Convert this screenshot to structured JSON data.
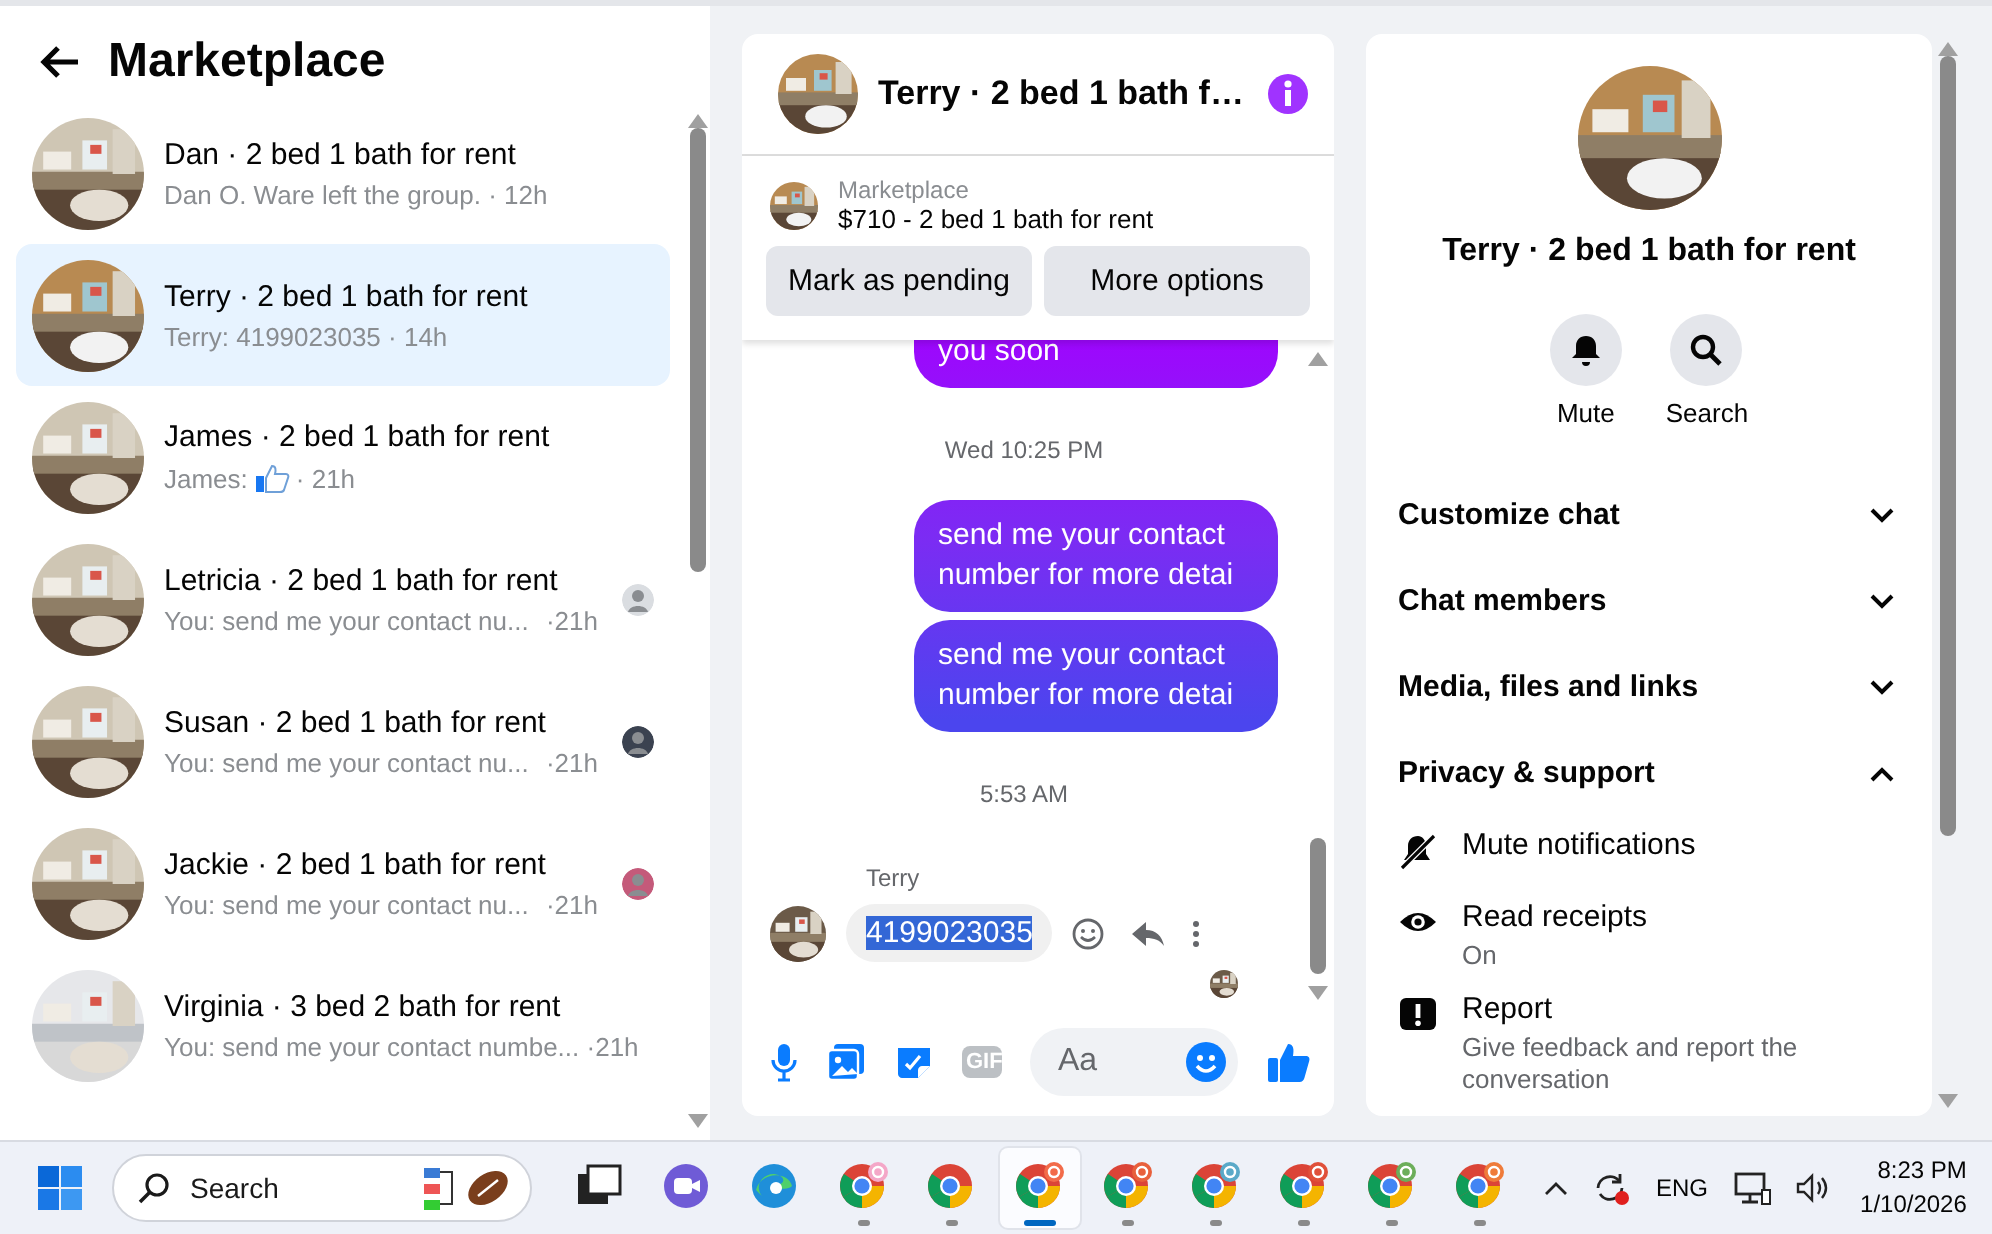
{
  "sidebar": {
    "title": "Marketplace",
    "conversations": [
      {
        "title": "Dan · 2 bed 1 bath for rent",
        "preview": "Dan O. Ware left the group. · 12h",
        "selected": false
      },
      {
        "title": "Terry · 2 bed 1 bath for rent",
        "preview": "Terry: 4199023035 · 14h",
        "selected": true
      },
      {
        "title": "James · 2 bed 1 bath for rent",
        "preview": "James:",
        "preview_like": true,
        "time": "· 21h",
        "selected": false
      },
      {
        "title": "Letricia · 2 bed 1 bath for rent",
        "preview": "You: send me your contact nu...",
        "time": "·21h",
        "selected": false,
        "seen_by": {
          "color": "#dadde1"
        }
      },
      {
        "title": "Susan · 2 bed 1 bath for rent",
        "preview": "You: send me your contact nu...",
        "time": "·21h",
        "selected": false,
        "seen_by": {
          "color": "#3b4250"
        }
      },
      {
        "title": "Jackie · 2 bed 1 bath for rent",
        "preview": "You: send me your contact nu...",
        "time": "·21h",
        "selected": false,
        "seen_by": {
          "color": "#c45a7a"
        }
      },
      {
        "title": "Virginia · 3 bed 2 bath for rent",
        "preview": "You: send me your contact numbe... ·21h",
        "selected": false
      }
    ]
  },
  "chat": {
    "title": "Terry · 2 bed 1 bath f…",
    "listing": {
      "source": "Marketplace",
      "name": "$710 - 2 bed 1 bath for rent"
    },
    "actions": [
      "Mark as pending",
      "More options"
    ],
    "messages": [
      {
        "kind": "sent",
        "text": "you soon"
      },
      {
        "kind": "time",
        "text": "Wed 10:25 PM"
      },
      {
        "kind": "sent",
        "text": "send me your contact number for more detai"
      },
      {
        "kind": "sent",
        "text": "send me your contact number for more detai"
      },
      {
        "kind": "time",
        "text": "5:53 AM"
      },
      {
        "kind": "received",
        "sender": "Terry",
        "text": "4199023035",
        "text_selected": true
      }
    ],
    "composer": {
      "gif": "GIF",
      "placeholder": "Aa"
    }
  },
  "details": {
    "title": "Terry · 2 bed 1 bath for rent",
    "quick_actions": [
      "Mute",
      "Search"
    ],
    "sections": [
      {
        "label": "Customize chat",
        "expanded": false
      },
      {
        "label": "Chat members",
        "expanded": false
      },
      {
        "label": "Media, files and links",
        "expanded": false
      },
      {
        "label": "Privacy & support",
        "expanded": true,
        "items": [
          {
            "kind": "mute",
            "label": "Mute notifications"
          },
          {
            "kind": "receipts",
            "label": "Read receipts",
            "detail": "On"
          },
          {
            "kind": "report",
            "label": "Report",
            "detail": "Give feedback and report the conversation"
          }
        ]
      }
    ]
  },
  "taskbar": {
    "search_placeholder": "Search",
    "apps": [
      {
        "kind": "desktop",
        "running": false,
        "active": false
      },
      {
        "kind": "chat",
        "running": false,
        "active": false
      },
      {
        "kind": "edge",
        "running": false,
        "active": false
      },
      {
        "kind": "browser",
        "running": true,
        "active": false,
        "color": "#f4a7c8"
      },
      {
        "kind": "browser",
        "running": true,
        "active": false
      },
      {
        "kind": "browser",
        "running": true,
        "active": true,
        "color": "#f26b4a"
      },
      {
        "kind": "browser",
        "running": true,
        "active": false,
        "color": "#e8603c"
      },
      {
        "kind": "browser",
        "running": true,
        "active": false,
        "color": "#5aa9c8"
      },
      {
        "kind": "browser",
        "running": true,
        "active": false,
        "color": "#e0503a"
      },
      {
        "kind": "browser",
        "running": true,
        "active": false,
        "color": "#6cae5a"
      },
      {
        "kind": "browser",
        "running": true,
        "active": false,
        "color": "#ef7b3a"
      }
    ],
    "language": "ENG",
    "time": "8:23 PM",
    "date": "1/10/2026"
  }
}
